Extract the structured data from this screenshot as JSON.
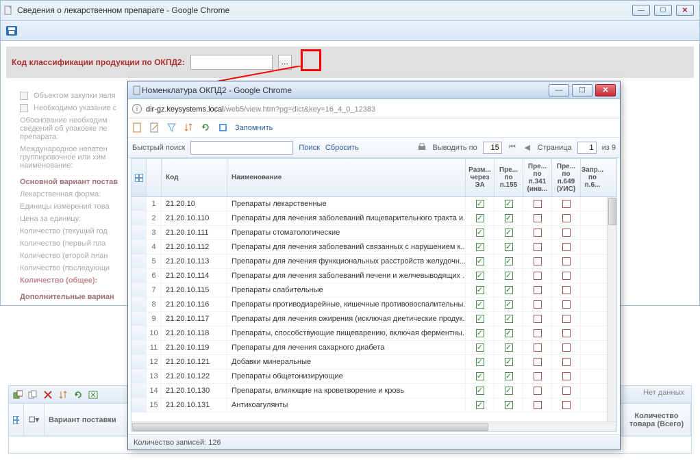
{
  "outer": {
    "title": "Сведения о лекарственном препарате - Google Chrome"
  },
  "form": {
    "okpd_label": "Код классификации продукции по ОКПД2:",
    "chk1": "Объектом закупки явля",
    "chk2": "Необходимо указание с",
    "just": "Обоснование необходим\nсведений об упаковке ле\nпрепарата:",
    "intl": "Международное непатен\nгруппировочное или хим\nнаименование:",
    "variant_heading": "Основной вариант постав",
    "lekform": "Лекарственная форма:",
    "units": "Единицы измерения това",
    "price": "Цена за единицу:",
    "qty_cur": "Количество (текущий год",
    "qty1": "Количество (первый пла",
    "qty2": "Количество (второй план",
    "qty_last": "Количество (последующи",
    "qty_total": "Количество (общее):",
    "add_var": "Дополнительные вариан"
  },
  "bottom": {
    "variant": "Вариант поставки",
    "qty_col": "Количество товара (Всего)",
    "no_data": "Нет данных"
  },
  "popup": {
    "title": "Номенклатура ОКПД2 - Google Chrome",
    "url_host": "dir-gz.keysystems.local",
    "url_path": "/web5/view.htm?pg=dict&key=16_4_0_12383",
    "remember": "Запомнить",
    "search": {
      "label": "Быстрый поиск",
      "find": "Поиск",
      "reset": "Сбросить",
      "show_by": "Выводить по",
      "page_size": "15",
      "page_label": "Страница",
      "page": "1",
      "of": "из 9"
    },
    "headers": {
      "code": "Код",
      "name": "Наименование",
      "c1": "Разм... через ЭА",
      "c2": "Пре... по п.155",
      "c3": "Пре... по п.341 (инв...",
      "c4": "Пре... по п.649 (УИС)",
      "c5": "Запр... по п.6..."
    },
    "rows": [
      {
        "n": 1,
        "code": "21.20.10",
        "name": "Препараты лекарственные",
        "c": [
          true,
          true,
          false,
          false
        ]
      },
      {
        "n": 2,
        "code": "21.20.10.110",
        "name": "Препараты для лечения заболеваний пищеварительного тракта и...",
        "c": [
          true,
          true,
          false,
          false
        ]
      },
      {
        "n": 3,
        "code": "21.20.10.111",
        "name": "Препараты стоматологические",
        "c": [
          true,
          true,
          false,
          false
        ]
      },
      {
        "n": 4,
        "code": "21.20.10.112",
        "name": "Препараты для лечения заболеваний связанных с нарушением к...",
        "c": [
          true,
          true,
          false,
          false
        ]
      },
      {
        "n": 5,
        "code": "21.20.10.113",
        "name": "Препараты для лечения функциональных расстройств желудочн...",
        "c": [
          true,
          true,
          false,
          false
        ]
      },
      {
        "n": 6,
        "code": "21.20.10.114",
        "name": "Препараты для лечения заболеваний печени и желчевыводящих ...",
        "c": [
          true,
          true,
          false,
          false
        ]
      },
      {
        "n": 7,
        "code": "21.20.10.115",
        "name": "Препараты слабительные",
        "c": [
          true,
          true,
          false,
          false
        ]
      },
      {
        "n": 8,
        "code": "21.20.10.116",
        "name": "Препараты противодиарейные, кишечные противовоспалительны...",
        "c": [
          true,
          true,
          false,
          false
        ]
      },
      {
        "n": 9,
        "code": "21.20.10.117",
        "name": "Препараты для лечения ожирения (исключая диетические продук...",
        "c": [
          true,
          true,
          false,
          false
        ]
      },
      {
        "n": 10,
        "code": "21.20.10.118",
        "name": "Препараты, способствующие пищеварению, включая ферментны...",
        "c": [
          true,
          true,
          false,
          false
        ]
      },
      {
        "n": 11,
        "code": "21.20.10.119",
        "name": "Препараты для лечения сахарного диабета",
        "c": [
          true,
          true,
          false,
          false
        ]
      },
      {
        "n": 12,
        "code": "21.20.10.121",
        "name": "Добавки минеральные",
        "c": [
          true,
          true,
          false,
          false
        ]
      },
      {
        "n": 13,
        "code": "21.20.10.122",
        "name": "Препараты общетонизирующие",
        "c": [
          true,
          true,
          false,
          false
        ]
      },
      {
        "n": 14,
        "code": "21.20.10.130",
        "name": "Препараты, влияющие на кроветворение и кровь",
        "c": [
          true,
          true,
          false,
          false
        ]
      },
      {
        "n": 15,
        "code": "21.20.10.131",
        "name": "Антикоагулянты",
        "c": [
          true,
          true,
          false,
          false
        ]
      }
    ],
    "status": "Количество записей: 126"
  }
}
